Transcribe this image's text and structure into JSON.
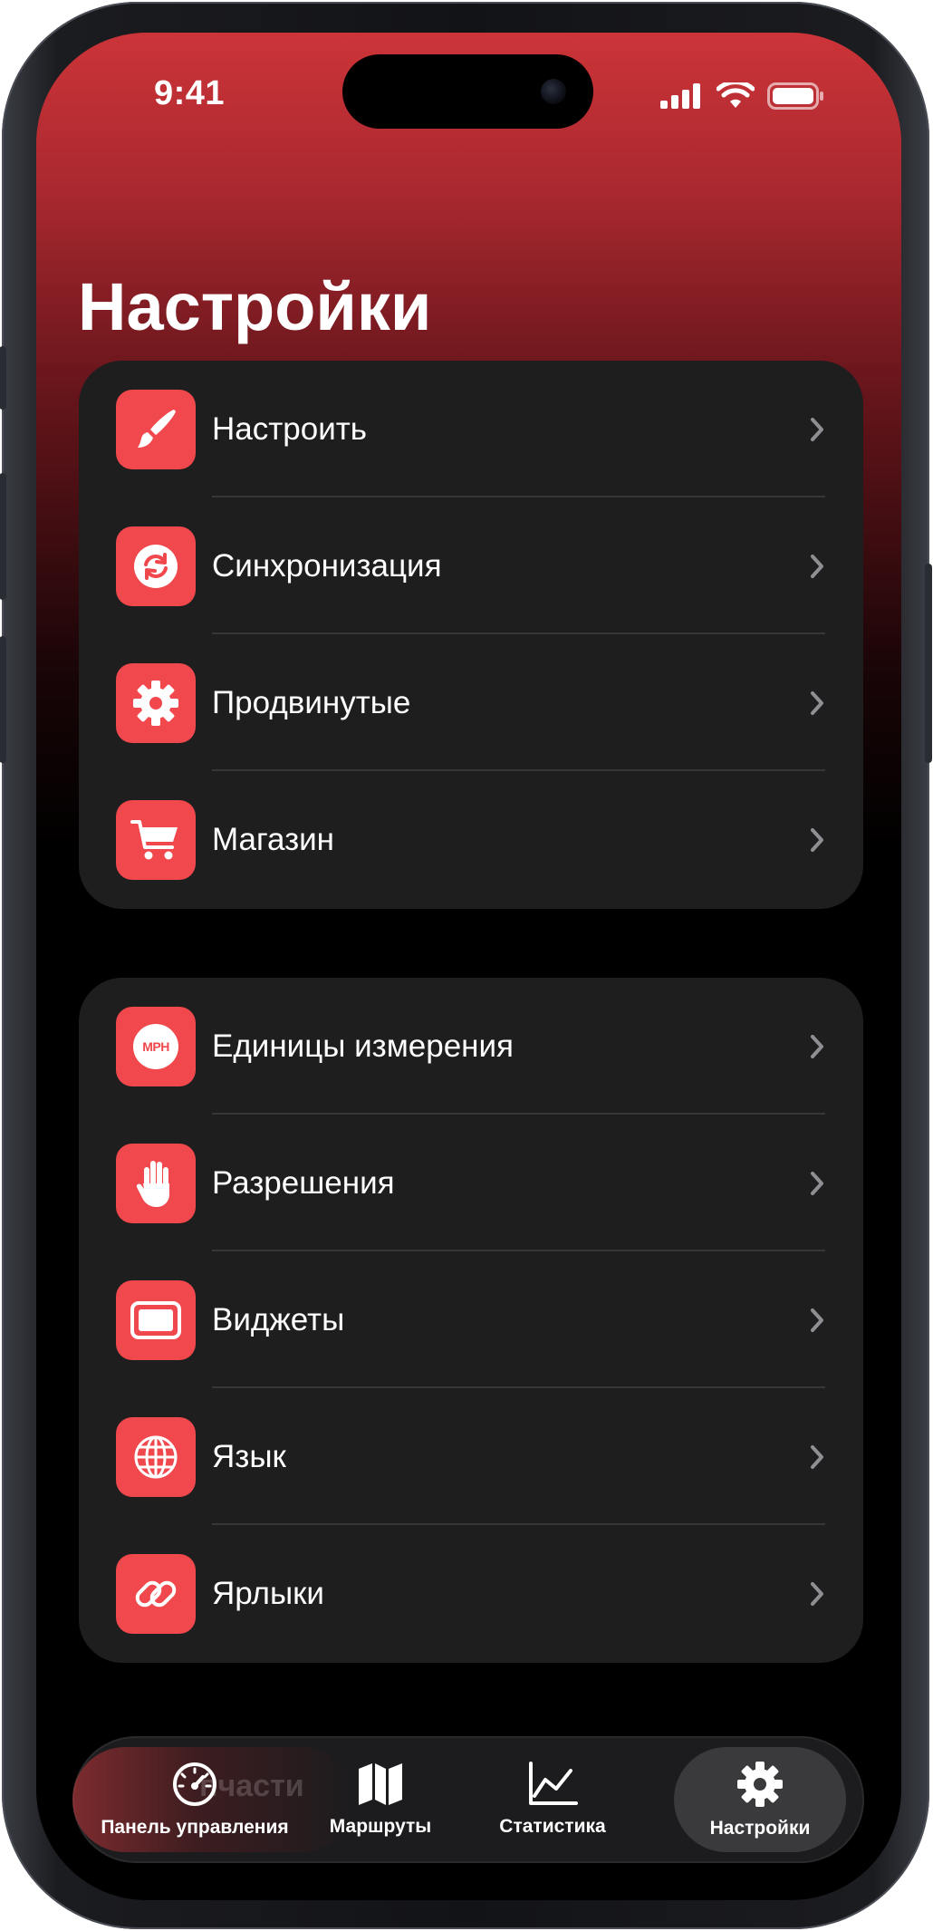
{
  "status_bar": {
    "time": "9:41"
  },
  "page": {
    "title": "Настройки"
  },
  "groups": [
    {
      "items": [
        {
          "label": "Настроить",
          "icon": "paintbrush-icon"
        },
        {
          "label": "Синхронизация",
          "icon": "sync-icon"
        },
        {
          "label": "Продвинутые",
          "icon": "gear-icon"
        },
        {
          "label": "Магазин",
          "icon": "cart-icon"
        }
      ]
    },
    {
      "items": [
        {
          "label": "Единицы измерения",
          "icon": "mph-icon",
          "icon_text": "MPH"
        },
        {
          "label": "Разрешения",
          "icon": "hand-icon"
        },
        {
          "label": "Виджеты",
          "icon": "widget-icon"
        },
        {
          "label": "Язык",
          "icon": "globe-icon"
        },
        {
          "label": "Ярлыки",
          "icon": "link-icon"
        }
      ]
    }
  ],
  "tab_bar": {
    "ghost_label": "пчасти",
    "tabs": [
      {
        "label": "Панель управления",
        "icon": "speedometer-icon",
        "active": false
      },
      {
        "label": "Маршруты",
        "icon": "map-icon",
        "active": false
      },
      {
        "label": "Статистика",
        "icon": "chart-icon",
        "active": false
      },
      {
        "label": "Настройки",
        "icon": "gear-icon",
        "active": true
      }
    ]
  },
  "colors": {
    "accent": "#f0484c",
    "header_gradient_top": "#cc3438",
    "card_background": "#1e1e1e",
    "active_tab_background": "#3a3a3c"
  }
}
